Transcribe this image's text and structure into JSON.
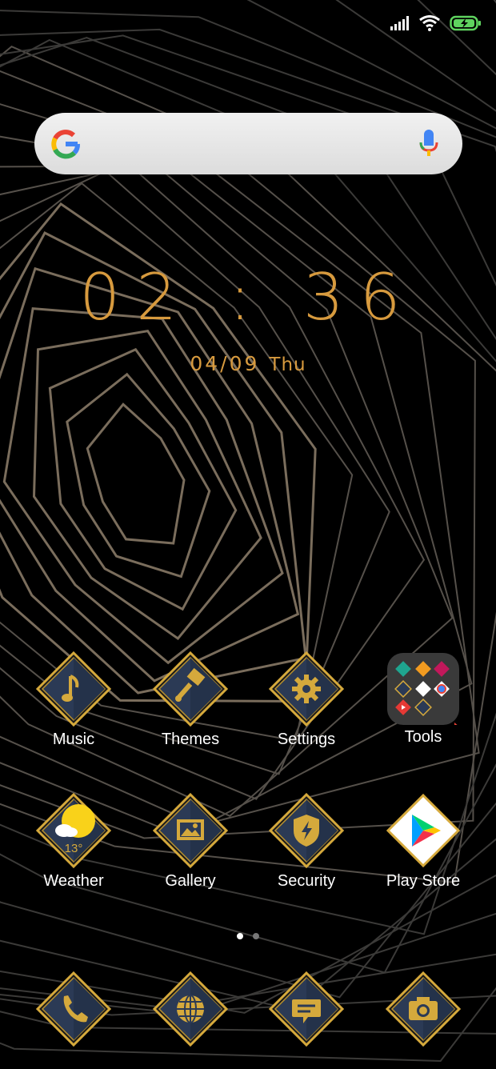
{
  "status_bar": {
    "icons": [
      "signal-icon",
      "wifi-icon",
      "battery-charging-icon"
    ],
    "battery_color": "#5fd35f"
  },
  "search": {
    "logo": "google-logo",
    "mic": "microphone-icon"
  },
  "clock": {
    "time": "02 : 36",
    "date": "04/09",
    "weekday": "Thu",
    "color": "#d79a3e"
  },
  "apps_row1": [
    {
      "label": "Music",
      "icon": "music-note-icon"
    },
    {
      "label": "Themes",
      "icon": "paintbrush-icon"
    },
    {
      "label": "Settings",
      "icon": "gear-icon"
    },
    {
      "label": "Tools",
      "icon": "folder-icon"
    }
  ],
  "apps_row2": [
    {
      "label": "Weather",
      "icon": "weather-sun-icon",
      "temp": "13°"
    },
    {
      "label": "Gallery",
      "icon": "image-icon"
    },
    {
      "label": "Security",
      "icon": "shield-bolt-icon"
    },
    {
      "label": "Play Store",
      "icon": "play-store-icon"
    }
  ],
  "page_indicator": {
    "pages": 2,
    "current": 1
  },
  "dock": [
    {
      "icon": "phone-icon"
    },
    {
      "icon": "globe-icon"
    },
    {
      "icon": "message-icon"
    },
    {
      "icon": "camera-icon"
    }
  ],
  "theme": {
    "gold": "#d5a93c",
    "navy": "#2b3a55"
  }
}
